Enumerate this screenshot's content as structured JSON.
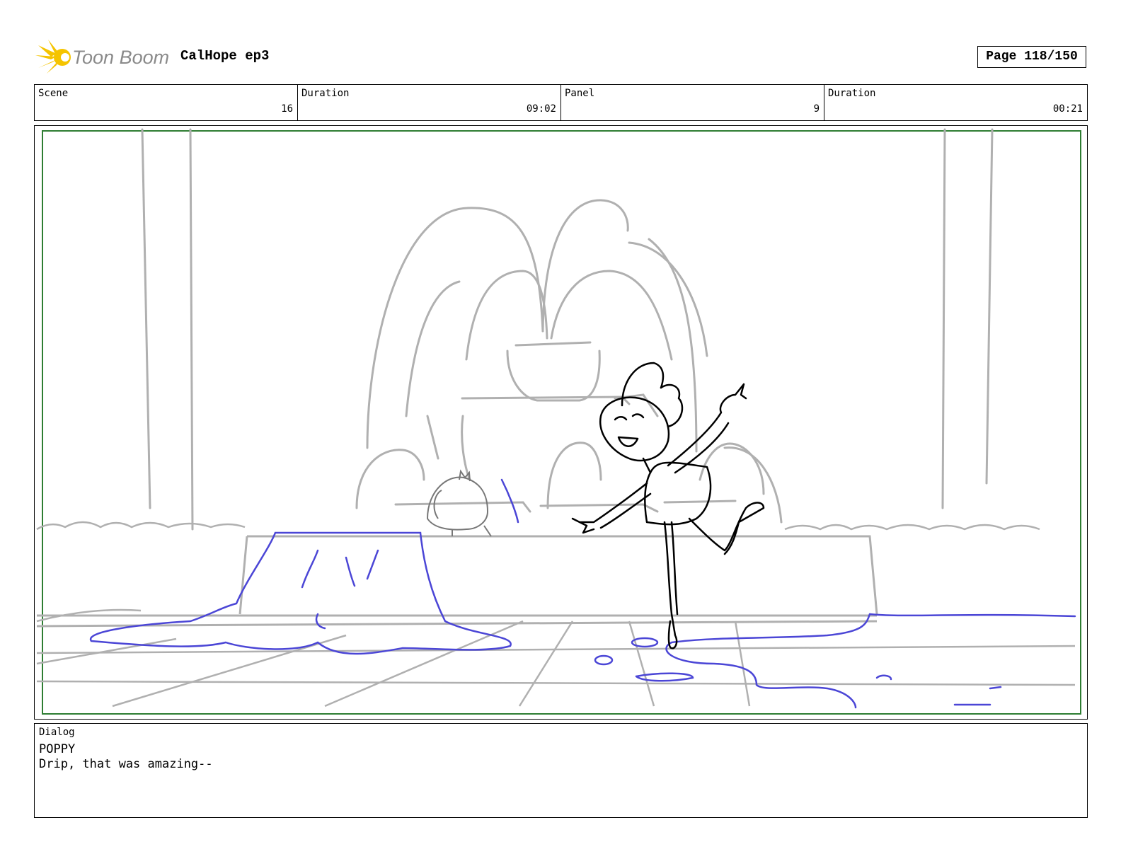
{
  "header": {
    "logo_text": "Toon Boom",
    "project_title": "CalHope ep3",
    "page_label": "Page 118/150"
  },
  "info": {
    "scene_label": "Scene",
    "scene_value": "16",
    "duration1_label": "Duration",
    "duration1_value": "09:02",
    "panel_label": "Panel",
    "panel_value": "9",
    "duration2_label": "Duration",
    "duration2_value": "00:21"
  },
  "panel": {
    "image_icon": "storyboard-sketch",
    "safe_frame_color": "#2e7d32",
    "sketch_gray": "#b0b0b0",
    "water_blue": "#4b46d6",
    "character_ink": "#000000"
  },
  "dialog": {
    "label": "Dialog",
    "speaker": "POPPY",
    "line": "Drip, that was amazing--"
  },
  "colors": {
    "logo_yellow": "#f5c400",
    "logo_gray": "#8a8a8a"
  }
}
